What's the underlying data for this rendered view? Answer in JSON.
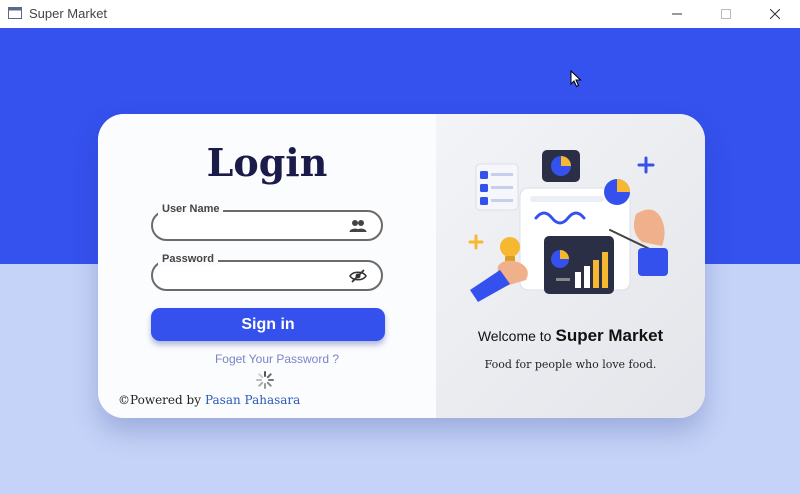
{
  "window": {
    "title": "Super Market",
    "minimize_glyph": "—",
    "close_glyph": "✕"
  },
  "login": {
    "title": "Login",
    "username": {
      "label": "User Name",
      "value": "",
      "icon": "users-icon"
    },
    "password": {
      "label": "Password",
      "value": "",
      "icon": "eye-off-icon"
    },
    "signin_label": "Sign in",
    "forgot_label": "Foget Your Password ?",
    "powered_prefix": "©Powered by",
    "powered_author": "Pasan Pahasara"
  },
  "welcome": {
    "prefix": "Welcome to",
    "brand": "Super Market",
    "tagline": "Food for people who love food."
  },
  "colors": {
    "primary": "#3451ee",
    "background_top": "#3551ee",
    "background_bottom": "#c5d3f8",
    "title_text": "#1b1b4a",
    "link": "#7b84c9",
    "accent_yellow": "#f5b830"
  }
}
